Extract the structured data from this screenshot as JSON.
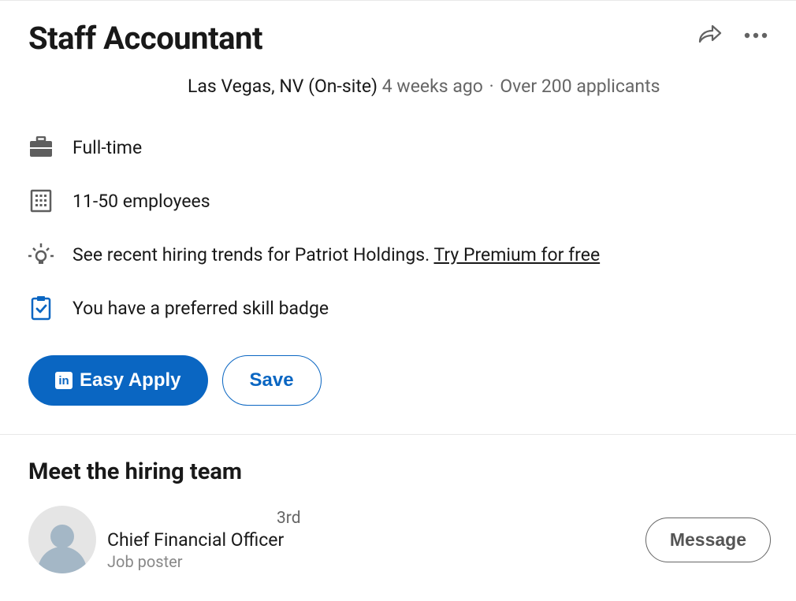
{
  "job": {
    "title": "Staff Accountant",
    "location": "Las Vegas, NV (On-site)",
    "posted": "4 weeks ago",
    "applicants": "Over 200 applicants"
  },
  "details": {
    "employment_type": "Full-time",
    "company_size": "11-50 employees",
    "insights": "See recent hiring trends for Patriot Holdings.",
    "premium_cta": "Try Premium for free",
    "skill_badge": "You have a preferred skill badge"
  },
  "buttons": {
    "apply": "Easy Apply",
    "save": "Save",
    "message": "Message"
  },
  "hiring": {
    "section_title": "Meet the hiring team",
    "connection_degree": "3rd",
    "role": "Chief Financial Officer",
    "poster_label": "Job poster"
  }
}
